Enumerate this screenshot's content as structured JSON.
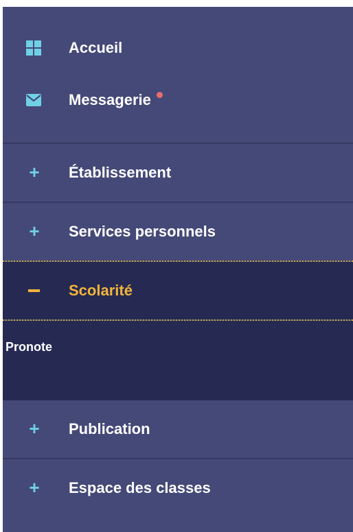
{
  "menu": {
    "top_items": [
      {
        "label": "Accueil",
        "icon": "grid-icon"
      },
      {
        "label": "Messagerie",
        "icon": "envelope-icon",
        "has_notification": true
      }
    ],
    "sections": [
      {
        "label": "Établissement",
        "toggle": "+",
        "expanded": false
      },
      {
        "label": "Services personnels",
        "toggle": "+",
        "expanded": false
      },
      {
        "label": "Scolarité",
        "toggle": "−",
        "expanded": true,
        "subitems": [
          {
            "label": "Pronote"
          }
        ]
      },
      {
        "label": "Publication",
        "toggle": "+",
        "expanded": false
      },
      {
        "label": "Espace des classes",
        "toggle": "+",
        "expanded": false
      }
    ]
  },
  "colors": {
    "sidebar_bg": "#454977",
    "active_bg": "#262a52",
    "accent_cyan": "#6fd0e6",
    "active_text": "#f2b43c",
    "notification_dot": "#e86d6d",
    "text": "#ffffff"
  }
}
